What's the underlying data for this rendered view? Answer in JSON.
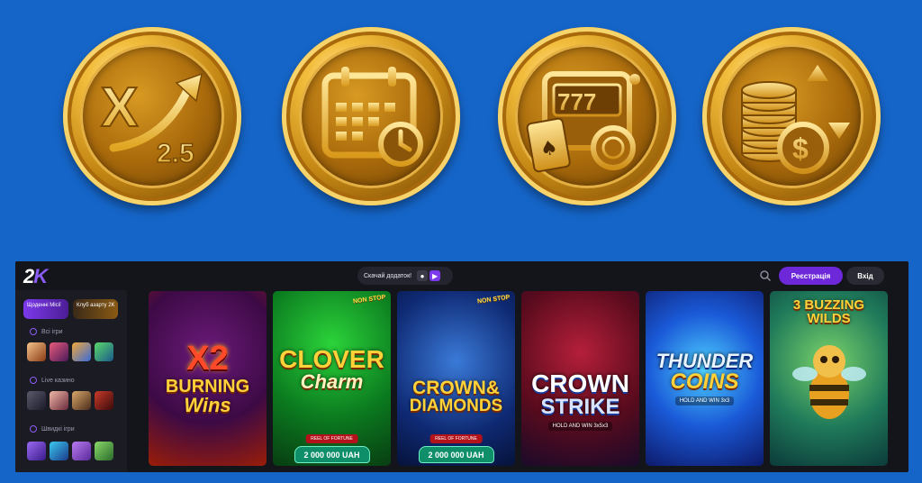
{
  "coins": [
    {
      "icon": "multiplier-arrow-icon",
      "text": "X",
      "subtext": "2.5"
    },
    {
      "icon": "calendar-clock-icon"
    },
    {
      "icon": "slot-machine-card-chip-icon",
      "text": "777"
    },
    {
      "icon": "coin-stack-dollar-arrows-icon"
    }
  ],
  "site": {
    "logo": {
      "main": "2",
      "accent": "K"
    },
    "app_download": {
      "label": "Скачай додаток!",
      "icons": [
        "apple-icon",
        "play-store-icon"
      ]
    },
    "register_label": "Реєстрація",
    "login_label": "Вхід",
    "sidebar": {
      "cards": [
        "Щоденні Місії",
        "Клуб азарту 2K"
      ],
      "sections": [
        {
          "label": "Всі ігри",
          "icon": "all-games-icon"
        },
        {
          "label": "Live казино",
          "icon": "live-casino-icon"
        },
        {
          "label": "Швидкі ігри",
          "icon": "fast-games-icon"
        }
      ]
    },
    "games": [
      {
        "line1": "X2",
        "line2": "BURNING",
        "line3": "Wins"
      },
      {
        "line1": "CLOVER",
        "line2": "Charm",
        "badge": "2 000 000 UAH",
        "sub": "REEL OF FORTUNE",
        "corner": "NON STOP"
      },
      {
        "line1": "CROWN&",
        "line2": "DIAMONDS",
        "badge": "2 000 000 UAH",
        "sub": "REEL OF FORTUNE",
        "corner": "NON STOP"
      },
      {
        "line1": "CROWN",
        "line2": "STRIKE",
        "note": "HOLD AND WIN 3x5x3"
      },
      {
        "line1": "THUNDER",
        "line2": "COINS",
        "note": "HOLD AND WIN 3x3"
      },
      {
        "line1": "3 BUZZING",
        "line2": "WILDS"
      }
    ]
  }
}
